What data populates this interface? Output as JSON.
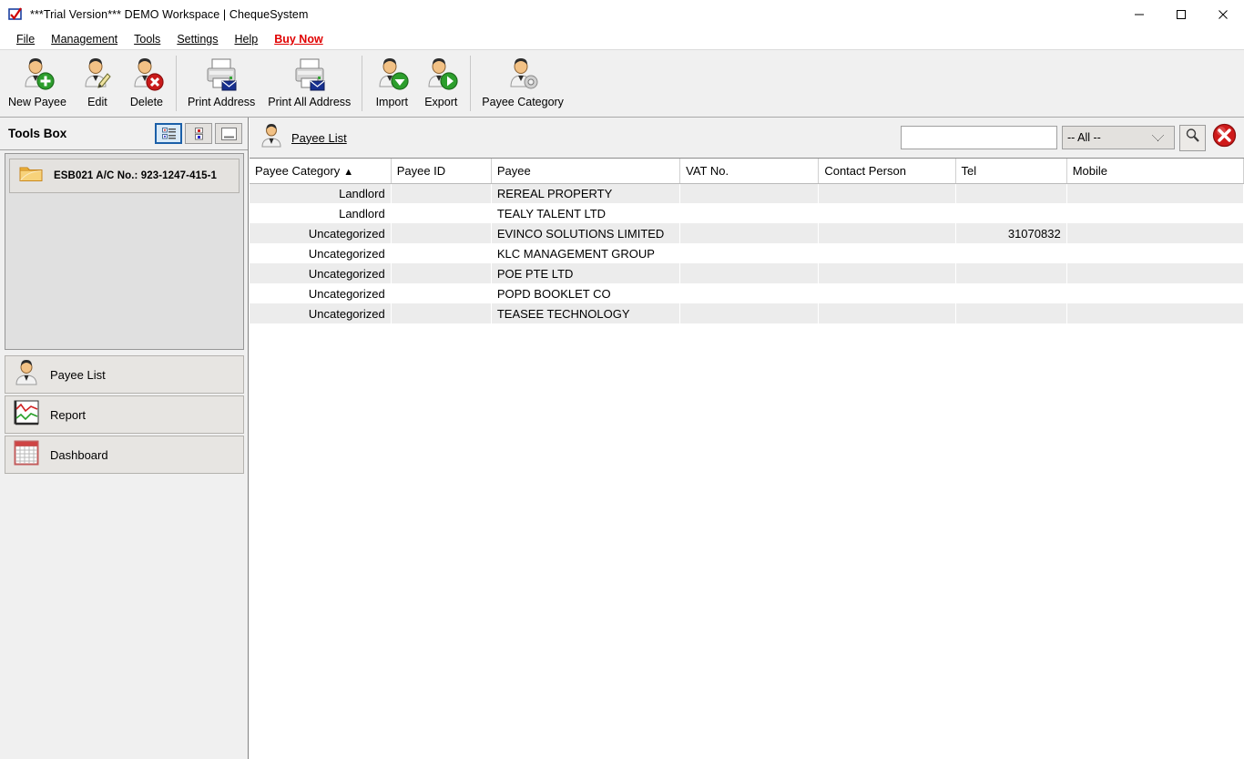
{
  "window": {
    "title": "***Trial Version*** DEMO Workspace | ChequeSystem",
    "app_icon": "cheque-tick-icon",
    "minimize_label": "—",
    "maximize_label": "□",
    "close_label": "✕"
  },
  "menubar": {
    "items": [
      {
        "label": "File",
        "mnemonic": "F"
      },
      {
        "label": "Management",
        "mnemonic": "M"
      },
      {
        "label": "Tools",
        "mnemonic": "T"
      },
      {
        "label": "Settings",
        "mnemonic": "S"
      },
      {
        "label": "Help",
        "mnemonic": "H"
      },
      {
        "label": "Buy Now",
        "mnemonic": "B",
        "accent": "#e00000"
      }
    ]
  },
  "toolbar": {
    "groups": [
      {
        "buttons": [
          {
            "label": "New Payee",
            "icon": "user-add-icon"
          },
          {
            "label": "Edit",
            "icon": "user-edit-icon"
          },
          {
            "label": "Delete",
            "icon": "user-delete-icon"
          }
        ]
      },
      {
        "buttons": [
          {
            "label": "Print Address",
            "icon": "printer-envelope-icon"
          },
          {
            "label": "Print All Address",
            "icon": "printer-envelope-icon"
          }
        ]
      },
      {
        "buttons": [
          {
            "label": "Import",
            "icon": "user-import-icon"
          },
          {
            "label": "Export",
            "icon": "user-export-icon"
          }
        ]
      },
      {
        "buttons": [
          {
            "label": "Payee Category",
            "icon": "user-gear-icon"
          }
        ]
      }
    ]
  },
  "sidebar": {
    "title": "Tools Box",
    "view_modes": [
      {
        "name": "list-view",
        "selected": true
      },
      {
        "name": "detail-view",
        "selected": false
      },
      {
        "name": "minimize-view",
        "selected": false
      }
    ],
    "accounts": [
      {
        "label": "ESB021 A/C No.: 923-1247-415-1",
        "icon": "folder-icon"
      }
    ],
    "nav_items": [
      {
        "label": "Payee List",
        "icon": "user-icon"
      },
      {
        "label": "Report",
        "icon": "chart-icon"
      },
      {
        "label": "Dashboard",
        "icon": "grid-icon"
      }
    ]
  },
  "main": {
    "tab": {
      "label": "Payee List",
      "icon": "user-icon"
    },
    "search": {
      "value": "",
      "placeholder": ""
    },
    "filter": {
      "selected": "-- All --",
      "options": [
        "-- All --"
      ]
    },
    "search_button_icon": "magnifier-icon",
    "clear_button_icon": "red-x-circle-icon",
    "table": {
      "columns": [
        {
          "label": "Payee Category",
          "sorted": "asc",
          "sort_glyph": "▲"
        },
        {
          "label": "Payee ID",
          "sorted": ""
        },
        {
          "label": "Payee",
          "sorted": ""
        },
        {
          "label": "VAT No.",
          "sorted": ""
        },
        {
          "label": "Contact Person",
          "sorted": ""
        },
        {
          "label": "Tel",
          "sorted": ""
        },
        {
          "label": "Mobile",
          "sorted": ""
        }
      ],
      "rows": [
        {
          "category": "Landlord",
          "payee_id": "",
          "payee": "REREAL PROPERTY",
          "vat_no": "",
          "contact_person": "",
          "tel": "",
          "mobile": ""
        },
        {
          "category": "Landlord",
          "payee_id": "",
          "payee": "TEALY TALENT LTD",
          "vat_no": "",
          "contact_person": "",
          "tel": "",
          "mobile": ""
        },
        {
          "category": "Uncategorized",
          "payee_id": "",
          "payee": "EVINCO SOLUTIONS LIMITED",
          "vat_no": "",
          "contact_person": "",
          "tel": "31070832",
          "mobile": ""
        },
        {
          "category": "Uncategorized",
          "payee_id": "",
          "payee": "KLC MANAGEMENT GROUP",
          "vat_no": "",
          "contact_person": "",
          "tel": "",
          "mobile": ""
        },
        {
          "category": "Uncategorized",
          "payee_id": "",
          "payee": "POE PTE LTD",
          "vat_no": "",
          "contact_person": "",
          "tel": "",
          "mobile": ""
        },
        {
          "category": "Uncategorized",
          "payee_id": "",
          "payee": "POPD BOOKLET CO",
          "vat_no": "",
          "contact_person": "",
          "tel": "",
          "mobile": ""
        },
        {
          "category": "Uncategorized",
          "payee_id": "",
          "payee": "TEASEE TECHNOLOGY",
          "vat_no": "",
          "contact_person": "",
          "tel": "",
          "mobile": ""
        }
      ]
    }
  },
  "colors": {
    "accent_red": "#e00000",
    "toolbar_bg": "#f0f0f0",
    "row_alt": "#ececec",
    "selected_border": "#1b5fa8"
  }
}
